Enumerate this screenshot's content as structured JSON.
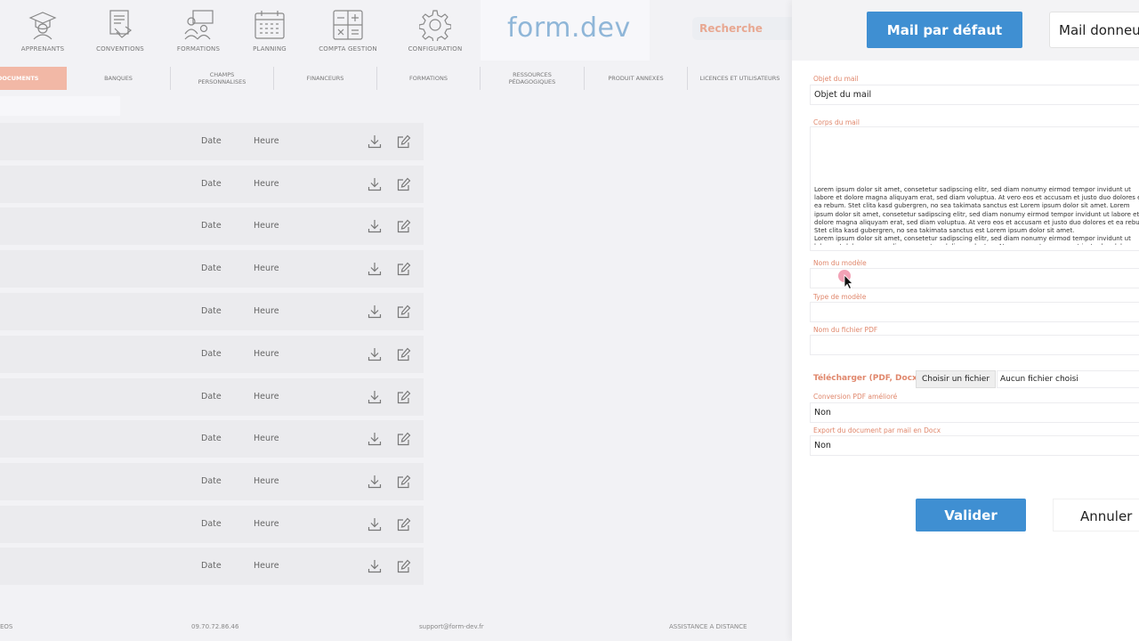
{
  "nav": {
    "items": [
      {
        "label": "APPRENANTS",
        "icon": "graduate-icon"
      },
      {
        "label": "CONVENTIONS",
        "icon": "handshake-document-icon"
      },
      {
        "label": "FORMATIONS",
        "icon": "presentation-icon"
      },
      {
        "label": "PLANNING",
        "icon": "calendar-icon"
      },
      {
        "label": "COMPTA GESTION",
        "icon": "calculator-icon"
      },
      {
        "label": "CONFIGURATION",
        "icon": "gear-icon"
      }
    ],
    "logo": "form.dev",
    "search_placeholder": "Recherche"
  },
  "subnav": {
    "tabs": [
      "DOCUMENTS",
      "BANQUES",
      "CHAMPS PERSONNALISES",
      "FINANCEURS",
      "FORMATIONS",
      "RESSOURCES PÉDAGOGIQUES",
      "PRODUIT ANNEXES",
      "LICENCES ET UTILISATEURS"
    ],
    "active": "DOCUMENTS"
  },
  "table": {
    "rows": [
      {
        "date": "Date",
        "heure": "Heure"
      },
      {
        "date": "Date",
        "heure": "Heure"
      },
      {
        "date": "Date",
        "heure": "Heure"
      },
      {
        "date": "Date",
        "heure": "Heure"
      },
      {
        "date": "Date",
        "heure": "Heure"
      },
      {
        "date": "Date",
        "heure": "Heure"
      },
      {
        "date": "Date",
        "heure": "Heure"
      },
      {
        "date": "Date",
        "heure": "Heure"
      },
      {
        "date": "Date",
        "heure": "Heure"
      },
      {
        "date": "Date",
        "heure": "Heure"
      },
      {
        "date": "Date",
        "heure": "Heure"
      }
    ]
  },
  "footer": {
    "left": "EOS",
    "phone": "09.70.72.86.46",
    "email": "support@form-dev.fr",
    "assist": "ASSISTANCE A DISTANCE"
  },
  "panel": {
    "header": {
      "mail_default_button": "Mail par défaut",
      "mail_donneur_button": "Mail donneur"
    },
    "form": {
      "objet_label": "Objet du mail",
      "objet_value": "Objet du mail",
      "corps_label": "Corps du mail",
      "corps_value": "Lorem ipsum dolor sit amet, consetetur sadipscing elitr, sed diam nonumy eirmod tempor invidunt ut labore et dolore magna aliquyam erat, sed diam voluptua. At vero eos et accusam et justo duo dolores et ea rebum. Stet clita kasd gubergren, no sea takimata sanctus est Lorem ipsum dolor sit amet. Lorem ipsum dolor sit amet, consetetur sadipscing elitr, sed diam nonumy eirmod tempor invidunt ut labore et dolore magna aliquyam erat, sed diam voluptua. At vero eos et accusam et justo duo dolores et ea rebum. Stet clita kasd gubergren, no sea takimata sanctus est Lorem ipsum dolor sit amet.\nLorem ipsum dolor sit amet, consetetur sadipscing elitr, sed diam nonumy eirmod tempor invidunt ut labore et dolore magna aliquyam erat, sed diam voluptua. At vero eos et accusam et justo duo dolores et ea rebum. Stet clita kasd gubergren",
      "nom_modele_label": "Nom du modèle",
      "nom_modele_value": "",
      "type_modele_label": "Type de modèle",
      "type_modele_value": "",
      "nom_pdf_label": "Nom du fichier PDF",
      "nom_pdf_value": "",
      "upload_label": "Télécharger (PDF, Docx)",
      "choose_file_button": "Choisir un fichier",
      "no_file_text": "Aucun fichier choisi",
      "conversion_label": "Conversion PDF amélioré",
      "conversion_value": "Non",
      "export_label": "Export du document par mail en Docx",
      "export_value": "Non"
    },
    "actions": {
      "validate": "Valider",
      "cancel": "Annuler"
    }
  },
  "colors": {
    "accent_blue": "#3f8fd2",
    "label_orange": "#e0876c",
    "active_tab": "#f2b8a6"
  }
}
